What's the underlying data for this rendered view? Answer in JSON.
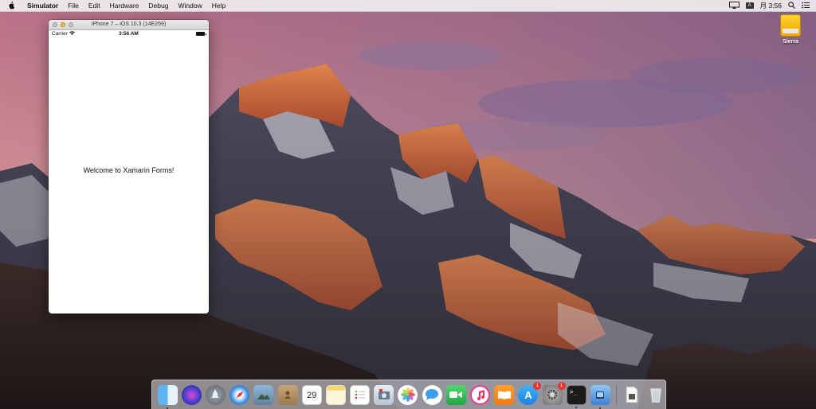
{
  "menubar": {
    "app_name": "Simulator",
    "items": [
      "File",
      "Edit",
      "Hardware",
      "Debug",
      "Window",
      "Help"
    ],
    "input_indicator": "A",
    "clock": "月 3:56"
  },
  "desktop": {
    "drive_label": "Sierra"
  },
  "simulator": {
    "window_title": "iPhone 7 – iOS 10.3 (14E269)",
    "status_carrier": "Carrier",
    "status_time": "3:56 AM",
    "welcome_text": "Welcome to Xamarin Forms!"
  },
  "dock": {
    "calendar_day": "29",
    "calendar_month": "",
    "app_store_badge": "1",
    "system_prefs_badge": "1"
  },
  "colors": {
    "menubar": "#f0eef0",
    "accent_yellow": "#f2bd3c",
    "badge_red": "#e8322e"
  }
}
